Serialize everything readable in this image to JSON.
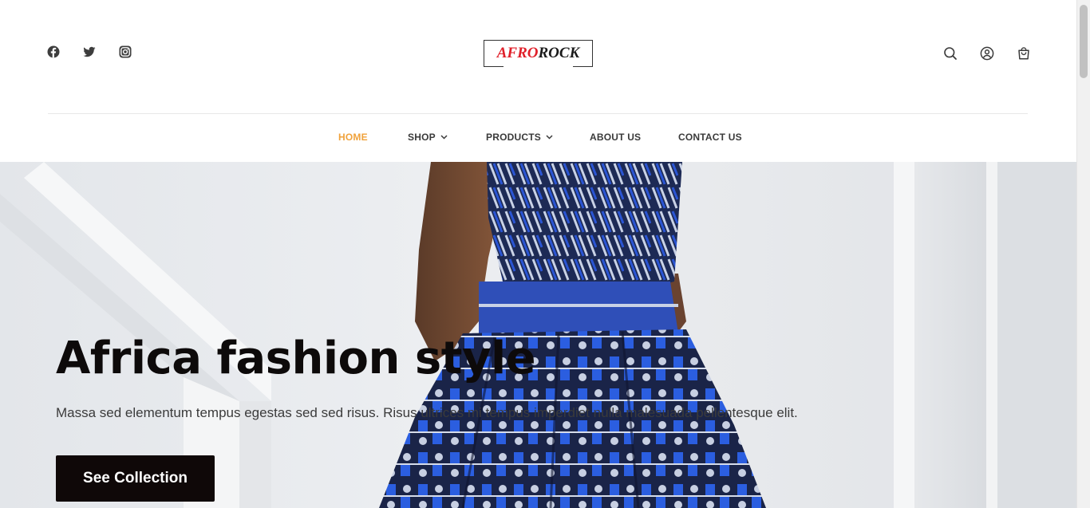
{
  "brand": {
    "logo_part1": "AFRO",
    "logo_part2": "ROCK"
  },
  "social": [
    {
      "icon": "facebook-icon"
    },
    {
      "icon": "twitter-icon"
    },
    {
      "icon": "instagram-icon"
    }
  ],
  "header_tools": [
    {
      "icon": "search-icon"
    },
    {
      "icon": "user-icon"
    },
    {
      "icon": "cart-icon"
    }
  ],
  "nav": {
    "items": [
      {
        "label": "HOME",
        "active": true
      },
      {
        "label": "SHOP",
        "dropdown": true
      },
      {
        "label": "PRODUCTS",
        "dropdown": true
      },
      {
        "label": "ABOUT US"
      },
      {
        "label": "CONTACT US"
      }
    ]
  },
  "hero": {
    "title": "Africa fashion style",
    "subtitle": "Massa sed elementum tempus egestas sed sed risus. Risus ultrices mi tempus imperdiet nulla malesuada pellentesque elit.",
    "button_label": "See Collection"
  },
  "colors": {
    "accent": "#f0a23b",
    "logo_red": "#e0202a",
    "button_bg": "#0f0808",
    "nav_text": "#3a3a3a"
  }
}
